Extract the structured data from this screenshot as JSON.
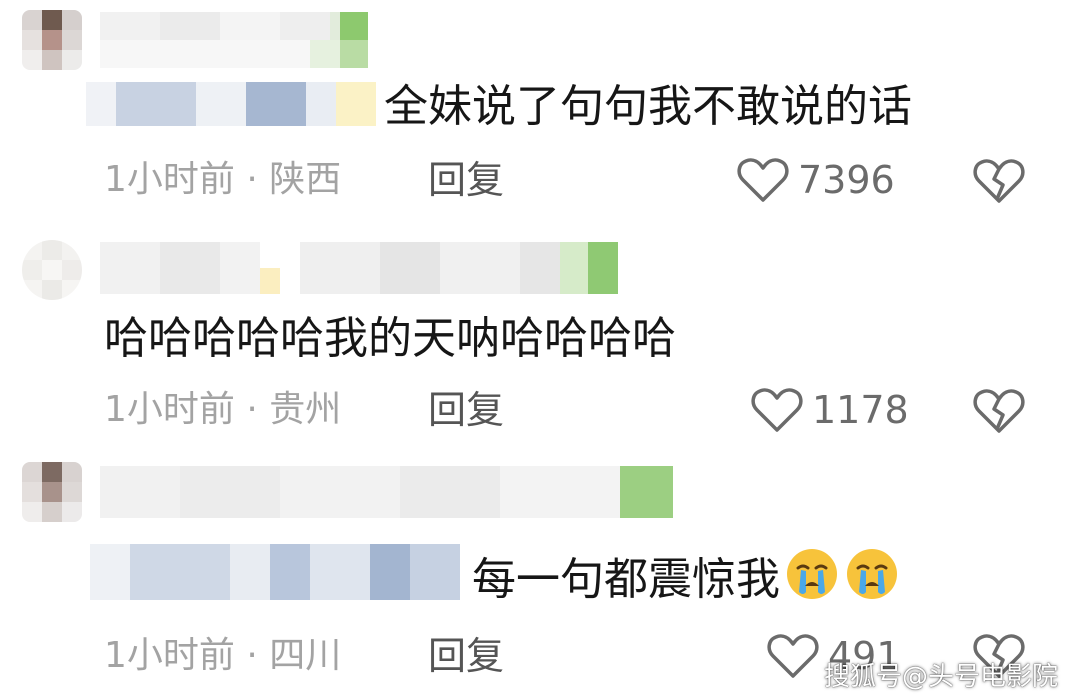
{
  "comments": [
    {
      "text": "全妹说了句句我不敢说的话",
      "time_location": "1小时前 · 陕西",
      "reply_label": "回复",
      "likes": "7396"
    },
    {
      "text": "哈哈哈哈哈我的天呐哈哈哈哈",
      "time_location": "1小时前 · 贵州",
      "reply_label": "回复",
      "likes": "1178"
    },
    {
      "text": "每一句都震惊我",
      "emoji": [
        "crying-face-emoji",
        "crying-face-emoji"
      ],
      "time_location": "1小时前 · 四川",
      "reply_label": "回复",
      "likes": "491"
    }
  ],
  "icons": {
    "like": "heart-outline-icon",
    "dislike": "broken-heart-icon"
  },
  "watermark": "搜狐号@头号电影院",
  "colors": {
    "text": "#161616",
    "meta": "#a3a3a3",
    "icon": "#6b6b6b"
  }
}
